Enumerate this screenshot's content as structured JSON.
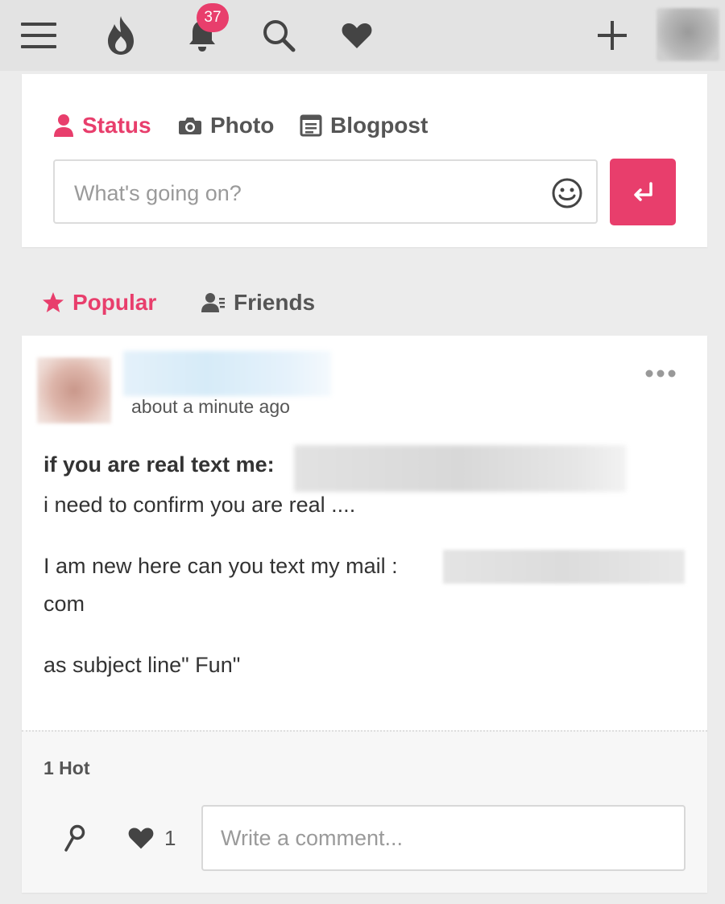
{
  "topbar": {
    "icons": [
      "menu-icon",
      "flame-icon",
      "bell-icon",
      "search-icon",
      "heart-icon",
      "plus-icon"
    ],
    "notification_count": "37"
  },
  "composer": {
    "tabs": [
      {
        "label": "Status",
        "icon": "user-icon",
        "active": true
      },
      {
        "label": "Photo",
        "icon": "camera-icon",
        "active": false
      },
      {
        "label": "Blogpost",
        "icon": "document-icon",
        "active": false
      }
    ],
    "placeholder": "What's going on?",
    "value": ""
  },
  "feed": {
    "tabs": [
      {
        "label": "Popular",
        "icon": "star-icon",
        "active": true
      },
      {
        "label": "Friends",
        "icon": "users-icon",
        "active": false
      }
    ]
  },
  "post": {
    "timestamp": "about a minute ago",
    "lines": [
      "if you are real text me:",
      "i need to confirm you are real ....",
      "I am new here can you text my mail :",
      "com",
      "as subject line\" Fun\""
    ],
    "hot_count": "1 Hot",
    "like_count": "1",
    "comment_placeholder": "Write a comment..."
  },
  "colors": {
    "accent": "#e83e6c",
    "topbar_bg": "#e3e3e3",
    "page_bg": "#ececec",
    "text": "#333333"
  }
}
